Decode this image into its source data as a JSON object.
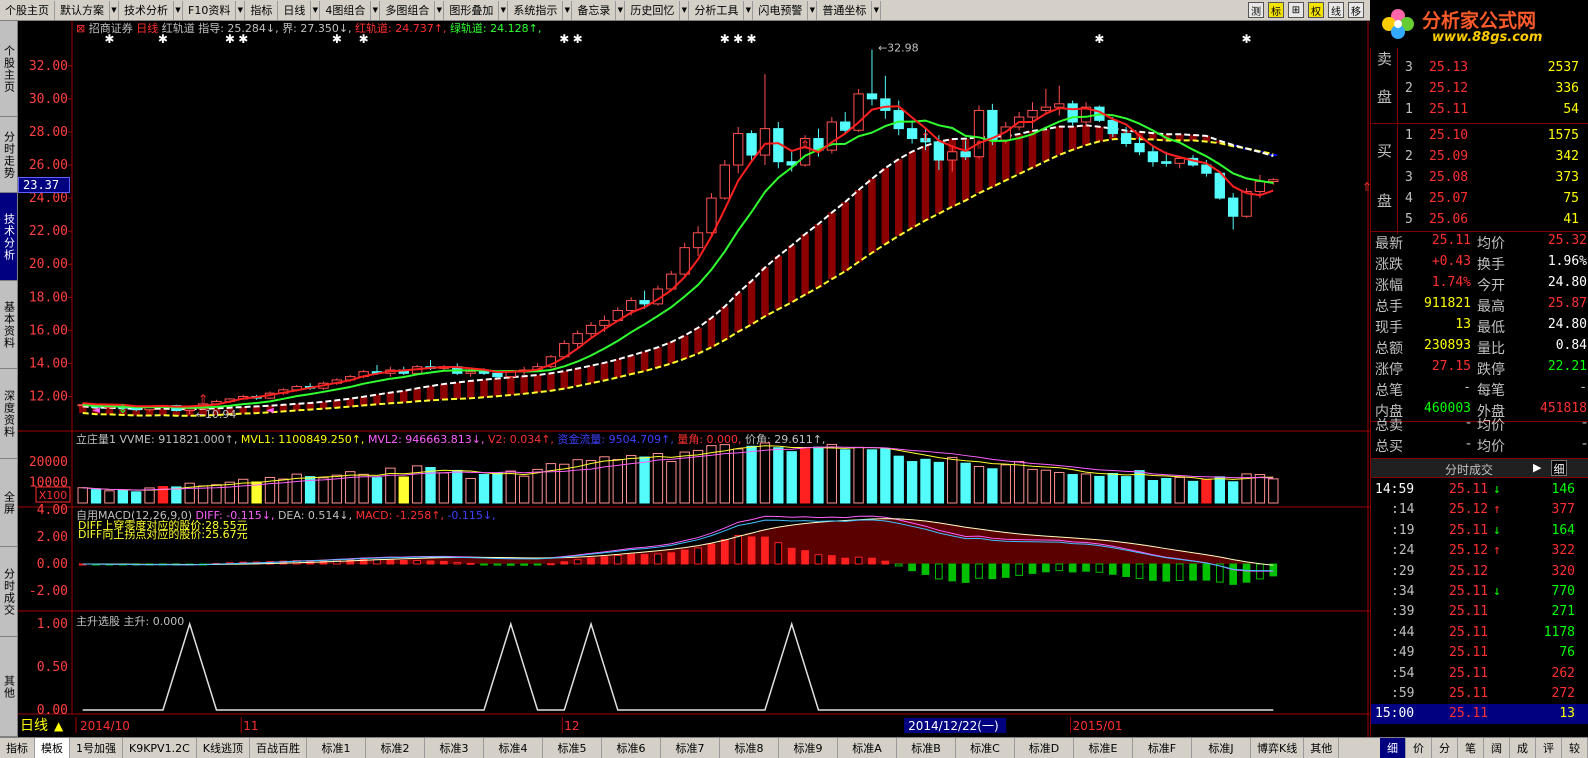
{
  "toolbar": {
    "items": [
      "个股主页",
      "默认方案",
      "技术分析",
      "F10资料",
      "指标",
      "日线",
      "4图组合",
      "多图组合",
      "图形叠加",
      "系统指示",
      "备忘录",
      "历史回忆",
      "分析工具",
      "闪电预警",
      "普通坐标"
    ],
    "right_items": [
      "测",
      "标",
      "⊞",
      "权",
      "线",
      "移"
    ],
    "active_right": [
      "标",
      "权"
    ]
  },
  "logo": {
    "title": "分析家公式网",
    "url": "www.88gs.com"
  },
  "left_tabs": [
    "个股主页",
    "分时走势",
    "技术分析",
    "基本资料",
    "深度资料",
    "全屏",
    "分时成交",
    "其他"
  ],
  "active_left_tab": "技术分析",
  "price_tag": "23.37",
  "main_header": {
    "stock": "招商证券",
    "period": "日线",
    "indicator": "红轨道",
    "items": [
      {
        "text": "指导: 25.284",
        "color": "#c0c0c0",
        "arrow": "↓"
      },
      {
        "text": "界: 27.350",
        "color": "#c0c0c0",
        "arrow": "↓"
      },
      {
        "text": "红轨道: 24.737",
        "color": "#ff3030",
        "arrow": "↑"
      },
      {
        "text": "绿轨道: 24.128",
        "color": "#30ff30",
        "arrow": "↑"
      }
    ]
  },
  "vol_header": {
    "name": "立庄量1",
    "items": [
      {
        "text": "VVME: 911821.000",
        "color": "#c0c0c0",
        "arrow": "↑"
      },
      {
        "text": "MVL1: 1100849.250",
        "color": "#ffff00",
        "arrow": "↑"
      },
      {
        "text": "MVL2: 946663.813",
        "color": "#ff60ff",
        "arrow": "↓"
      },
      {
        "text": "V2: 0.034",
        "color": "#ff3030",
        "arrow": "↑"
      },
      {
        "text": "资金流量: 9504.709",
        "color": "#4040ff",
        "arrow": "↑"
      },
      {
        "text": "量角: 0.000",
        "color": "#ff3030",
        "arrow": ""
      },
      {
        "text": "价角: 29.611",
        "color": "#c0c0c0",
        "arrow": "↑"
      }
    ],
    "badge": "X100"
  },
  "macd_header": {
    "name": "自用MACD(12,26,9,0)",
    "items": [
      {
        "text": "DIFF: -0.115",
        "color": "#ff60ff",
        "arrow": "↓"
      },
      {
        "text": "DEA: 0.514",
        "color": "#c0c0c0",
        "arrow": "↓"
      },
      {
        "text": "MACD: -1.258",
        "color": "#ff3030",
        "arrow": "↑"
      },
      {
        "text": "-0.115",
        "color": "#4040ff",
        "arrow": "↓"
      }
    ],
    "note1": "DIFF上穿零度对应的股价:28.55元",
    "note2": "DIFF向上拐点对应的股价:25.67元"
  },
  "zs_header": {
    "name": "主升选股",
    "items": [
      {
        "text": "主升: 0.000",
        "color": "#c0c0c0",
        "arrow": ""
      }
    ]
  },
  "chart_data": {
    "type": "candlestick",
    "price_axis": {
      "ticks": [
        "32.00",
        "30.00",
        "28.00",
        "26.00",
        "24.00",
        "22.00",
        "20.00",
        "18.00",
        "16.00",
        "14.00",
        "12.00"
      ]
    },
    "annotations": {
      "high": "32.98",
      "low": "10.94"
    },
    "vol_axis": {
      "ticks": [
        "20000",
        "10000"
      ]
    },
    "macd_axis": {
      "ticks": [
        "4.00",
        "2.00",
        "0.00",
        "-2.00"
      ]
    },
    "zs_axis": {
      "ticks": [
        "1.00",
        "0.50",
        "0.00"
      ]
    },
    "dates": {
      "start": "2014/10",
      "m1": "11",
      "m2": "12",
      "cursor": "2014/12/22(一)",
      "m3": "2015/01"
    },
    "candles": [
      [
        11.45,
        11.6,
        11.35,
        11.5
      ],
      [
        11.5,
        11.55,
        11.3,
        11.35
      ],
      [
        11.35,
        11.5,
        11.25,
        11.4
      ],
      [
        11.4,
        11.5,
        11.2,
        11.3
      ],
      [
        11.3,
        11.35,
        11.1,
        11.2
      ],
      [
        11.2,
        11.4,
        11.1,
        11.35
      ],
      [
        11.35,
        11.5,
        11.3,
        11.45
      ],
      [
        11.45,
        11.5,
        11.1,
        11.15
      ],
      [
        11.15,
        11.3,
        10.94,
        11.25
      ],
      [
        11.25,
        11.6,
        11.2,
        11.55
      ],
      [
        11.55,
        11.8,
        11.5,
        11.7
      ],
      [
        11.7,
        11.9,
        11.6,
        11.85
      ],
      [
        11.85,
        12.1,
        11.8,
        12.0
      ],
      [
        12.0,
        12.1,
        11.8,
        11.9
      ],
      [
        11.9,
        12.3,
        11.85,
        12.2
      ],
      [
        12.2,
        12.5,
        12.1,
        12.4
      ],
      [
        12.4,
        12.7,
        12.3,
        12.6
      ],
      [
        12.6,
        12.8,
        12.4,
        12.5
      ],
      [
        12.5,
        12.9,
        12.4,
        12.8
      ],
      [
        12.8,
        13.1,
        12.7,
        13.0
      ],
      [
        13.0,
        13.3,
        12.9,
        13.2
      ],
      [
        13.2,
        13.6,
        13.1,
        13.5
      ],
      [
        13.5,
        13.9,
        13.3,
        13.4
      ],
      [
        13.4,
        13.8,
        13.2,
        13.6
      ],
      [
        13.6,
        13.8,
        13.3,
        13.4
      ],
      [
        13.4,
        13.9,
        13.3,
        13.8
      ],
      [
        13.8,
        14.2,
        13.6,
        13.7
      ],
      [
        13.7,
        13.9,
        13.5,
        13.8
      ],
      [
        13.8,
        14.0,
        13.3,
        13.4
      ],
      [
        13.4,
        13.6,
        13.2,
        13.5
      ],
      [
        13.5,
        13.7,
        13.3,
        13.4
      ],
      [
        13.4,
        13.5,
        13.1,
        13.2
      ],
      [
        13.2,
        13.6,
        13.1,
        13.5
      ],
      [
        13.5,
        13.8,
        13.3,
        13.6
      ],
      [
        13.6,
        14.0,
        13.5,
        13.8
      ],
      [
        13.8,
        14.5,
        13.7,
        14.4
      ],
      [
        14.4,
        15.4,
        14.3,
        15.2
      ],
      [
        15.2,
        16.0,
        14.9,
        15.8
      ],
      [
        15.8,
        16.5,
        15.5,
        16.3
      ],
      [
        16.3,
        16.9,
        15.9,
        16.6
      ],
      [
        16.6,
        17.4,
        16.5,
        17.2
      ],
      [
        17.2,
        18.0,
        16.9,
        17.8
      ],
      [
        17.8,
        18.4,
        17.3,
        17.6
      ],
      [
        17.6,
        18.7,
        17.5,
        18.5
      ],
      [
        18.5,
        19.6,
        18.4,
        19.4
      ],
      [
        19.4,
        21.3,
        19.3,
        21.0
      ],
      [
        21.0,
        22.3,
        20.5,
        21.9
      ],
      [
        21.9,
        24.3,
        21.8,
        24.0
      ],
      [
        24.0,
        26.3,
        23.9,
        26.0
      ],
      [
        26.0,
        28.3,
        25.5,
        27.9
      ],
      [
        27.9,
        28.1,
        26.3,
        26.6
      ],
      [
        26.6,
        31.5,
        26.0,
        28.2
      ],
      [
        28.2,
        28.6,
        25.8,
        26.2
      ],
      [
        26.2,
        26.8,
        25.6,
        26.0
      ],
      [
        26.0,
        27.8,
        25.9,
        27.6
      ],
      [
        27.6,
        28.2,
        26.5,
        26.9
      ],
      [
        26.9,
        28.9,
        26.7,
        28.6
      ],
      [
        28.6,
        29.2,
        27.9,
        28.1
      ],
      [
        28.1,
        30.6,
        28.0,
        30.3
      ],
      [
        30.3,
        32.98,
        29.6,
        30.0
      ],
      [
        30.0,
        31.4,
        28.8,
        29.3
      ],
      [
        29.3,
        29.9,
        27.8,
        28.2
      ],
      [
        28.2,
        28.7,
        27.3,
        27.6
      ],
      [
        27.6,
        28.2,
        26.9,
        27.4
      ],
      [
        27.4,
        27.8,
        25.7,
        26.3
      ],
      [
        26.3,
        27.2,
        25.6,
        26.8
      ],
      [
        26.8,
        27.5,
        26.3,
        26.5
      ],
      [
        26.5,
        29.6,
        26.4,
        29.3
      ],
      [
        29.3,
        29.7,
        27.2,
        27.5
      ],
      [
        27.5,
        28.6,
        27.3,
        28.3
      ],
      [
        28.3,
        29.2,
        28.1,
        28.9
      ],
      [
        28.9,
        29.8,
        28.2,
        29.3
      ],
      [
        29.3,
        30.6,
        29.1,
        29.5
      ],
      [
        29.5,
        30.8,
        29.0,
        29.7
      ],
      [
        29.7,
        29.9,
        28.4,
        28.6
      ],
      [
        28.6,
        29.8,
        28.3,
        29.5
      ],
      [
        29.5,
        29.6,
        28.6,
        28.7
      ],
      [
        28.7,
        28.9,
        27.7,
        27.9
      ],
      [
        27.9,
        28.3,
        27.1,
        27.3
      ],
      [
        27.3,
        27.8,
        26.6,
        26.8
      ],
      [
        26.8,
        27.1,
        25.9,
        26.2
      ],
      [
        26.2,
        26.8,
        25.9,
        26.1
      ],
      [
        26.1,
        26.5,
        25.8,
        26.4
      ],
      [
        26.4,
        26.6,
        25.9,
        26.0
      ],
      [
        26.0,
        26.3,
        25.3,
        25.5
      ],
      [
        25.5,
        25.6,
        23.9,
        24.0
      ],
      [
        24.0,
        24.3,
        22.1,
        22.9
      ],
      [
        22.9,
        24.6,
        22.8,
        24.4
      ],
      [
        24.4,
        25.4,
        24.0,
        25.0
      ],
      [
        25.0,
        25.2,
        24.8,
        25.11
      ]
    ],
    "volume": [
      7400,
      6500,
      5900,
      6100,
      5400,
      7300,
      8000,
      7800,
      9600,
      8300,
      8900,
      10100,
      11500,
      10200,
      12400,
      11600,
      14000,
      12800,
      12200,
      13500,
      15200,
      13900,
      12300,
      16900,
      12600,
      18000,
      17200,
      14600,
      15800,
      11900,
      13800,
      14500,
      15500,
      13000,
      16300,
      19100,
      18800,
      21000,
      20600,
      22400,
      21100,
      23000,
      22300,
      24000,
      20100,
      24700,
      25500,
      27800,
      28300,
      26200,
      27500,
      29100,
      26800,
      24900,
      26200,
      27100,
      28400,
      25800,
      27000,
      25800,
      26300,
      22700,
      20100,
      21200,
      19700,
      22100,
      19300,
      17700,
      16600,
      18500,
      20100,
      16300,
      15900,
      14800,
      13800,
      14100,
      12900,
      14300,
      12800,
      15700,
      10900,
      11900,
      12400,
      10500,
      11500,
      12700,
      10300,
      14100,
      13800,
      11700,
      11600,
      10200,
      10300,
      9400,
      9900,
      12900,
      13500,
      11500,
      11200,
      9100
    ]
  },
  "orderbook": {
    "sell_label": "卖盘",
    "buy_label": "买盘",
    "sell": [
      {
        "lv": "3",
        "price": "25.13",
        "vol": "2537"
      },
      {
        "lv": "2",
        "price": "25.12",
        "vol": "336"
      },
      {
        "lv": "1",
        "price": "25.11",
        "vol": "54"
      }
    ],
    "buy": [
      {
        "lv": "1",
        "price": "25.10",
        "vol": "1575"
      },
      {
        "lv": "2",
        "price": "25.09",
        "vol": "342"
      },
      {
        "lv": "3",
        "price": "25.08",
        "vol": "373"
      },
      {
        "lv": "4",
        "price": "25.07",
        "vol": "75"
      },
      {
        "lv": "5",
        "price": "25.06",
        "vol": "41"
      }
    ]
  },
  "stats": [
    {
      "k1": "最新",
      "v1": "25.11",
      "c1": "#ff3030",
      "k2": "均价",
      "v2": "25.32",
      "c2": "#ff3030"
    },
    {
      "k1": "涨跌",
      "v1": "+0.43",
      "c1": "#ff3030",
      "k2": "换手",
      "v2": "1.96%",
      "c2": "#ffffff"
    },
    {
      "k1": "涨幅",
      "v1": "1.74%",
      "c1": "#ff3030",
      "k2": "今开",
      "v2": "24.80",
      "c2": "#ffffff"
    },
    {
      "k1": "总手",
      "v1": "911821",
      "c1": "#ffff00",
      "k2": "最高",
      "v2": "25.87",
      "c2": "#ff3030"
    },
    {
      "k1": "现手",
      "v1": "13",
      "c1": "#ffff00",
      "k2": "最低",
      "v2": "24.80",
      "c2": "#ffffff"
    },
    {
      "k1": "总额",
      "v1": "230893",
      "c1": "#ffff00",
      "k2": "量比",
      "v2": "0.84",
      "c2": "#ffffff"
    },
    {
      "k1": "涨停",
      "v1": "27.15",
      "c1": "#ff3030",
      "k2": "跌停",
      "v2": "22.21",
      "c2": "#00ff00"
    },
    {
      "k1": "总笔",
      "v1": "-",
      "c1": "#c0c0c0",
      "k2": "每笔",
      "v2": "-",
      "c2": "#c0c0c0"
    },
    {
      "k1": "内盘",
      "v1": "460003",
      "c1": "#00ff00",
      "k2": "外盘",
      "v2": "451818",
      "c2": "#ff3030"
    }
  ],
  "extra_rows": [
    {
      "k1": "总卖",
      "v1": "-",
      "k2": "均价",
      "v2": "-"
    },
    {
      "k1": "总买",
      "v1": "-",
      "k2": "均价",
      "v2": "-"
    }
  ],
  "ticks_header": "分时成交",
  "ticks_header_btn": "细",
  "ticks": [
    {
      "t": "14:59",
      "p": "25.11",
      "a": "↓",
      "v": "146",
      "vc": "#00ff00",
      "ac": "#00ff00"
    },
    {
      "t": ":14",
      "p": "25.12",
      "a": "↑",
      "v": "377",
      "vc": "#ff3030",
      "ac": "#ff3030"
    },
    {
      "t": ":19",
      "p": "25.11",
      "a": "↓",
      "v": "164",
      "vc": "#00ff00",
      "ac": "#00ff00"
    },
    {
      "t": ":24",
      "p": "25.12",
      "a": "↑",
      "v": "322",
      "vc": "#ff3030",
      "ac": "#ff3030"
    },
    {
      "t": ":29",
      "p": "25.12",
      "a": "",
      "v": "320",
      "vc": "#ff3030",
      "ac": "#ff3030"
    },
    {
      "t": ":34",
      "p": "25.11",
      "a": "↓",
      "v": "770",
      "vc": "#00ff00",
      "ac": "#00ff00"
    },
    {
      "t": ":39",
      "p": "25.11",
      "a": "",
      "v": "271",
      "vc": "#00ff00",
      "ac": "#00ff00"
    },
    {
      "t": ":44",
      "p": "25.11",
      "a": "",
      "v": "1178",
      "vc": "#00ff00",
      "ac": "#00ff00"
    },
    {
      "t": ":49",
      "p": "25.11",
      "a": "",
      "v": "76",
      "vc": "#00ff00",
      "ac": "#00ff00"
    },
    {
      "t": ":54",
      "p": "25.11",
      "a": "",
      "v": "262",
      "vc": "#ff3030",
      "ac": "#ff3030"
    },
    {
      "t": ":59",
      "p": "25.11",
      "a": "",
      "v": "272",
      "vc": "#ff3030",
      "ac": "#ff3030"
    },
    {
      "t": "15:00",
      "p": "25.11",
      "a": "",
      "v": "13",
      "vc": "#ffff00",
      "ac": "#ffff00"
    }
  ],
  "bottom_tabs": [
    "指标",
    "模板",
    "1号加强",
    "K9KPV1.2C",
    "K线逃顶",
    "百战百胜",
    "标准1",
    "标准2",
    "标准3",
    "标准4",
    "标准5",
    "标准6",
    "标准7",
    "标准8",
    "标准9",
    "标准A",
    "标准B",
    "标准C",
    "标准D",
    "标准E",
    "标准F",
    "标准J",
    "博弈K线",
    "其他"
  ],
  "active_bottom_tab": "模板",
  "bottom_right_tabs": [
    "细",
    "价",
    "分",
    "笔",
    "阔",
    "成",
    "评",
    "较"
  ],
  "active_bottom_right": "细",
  "period_label": "日线"
}
